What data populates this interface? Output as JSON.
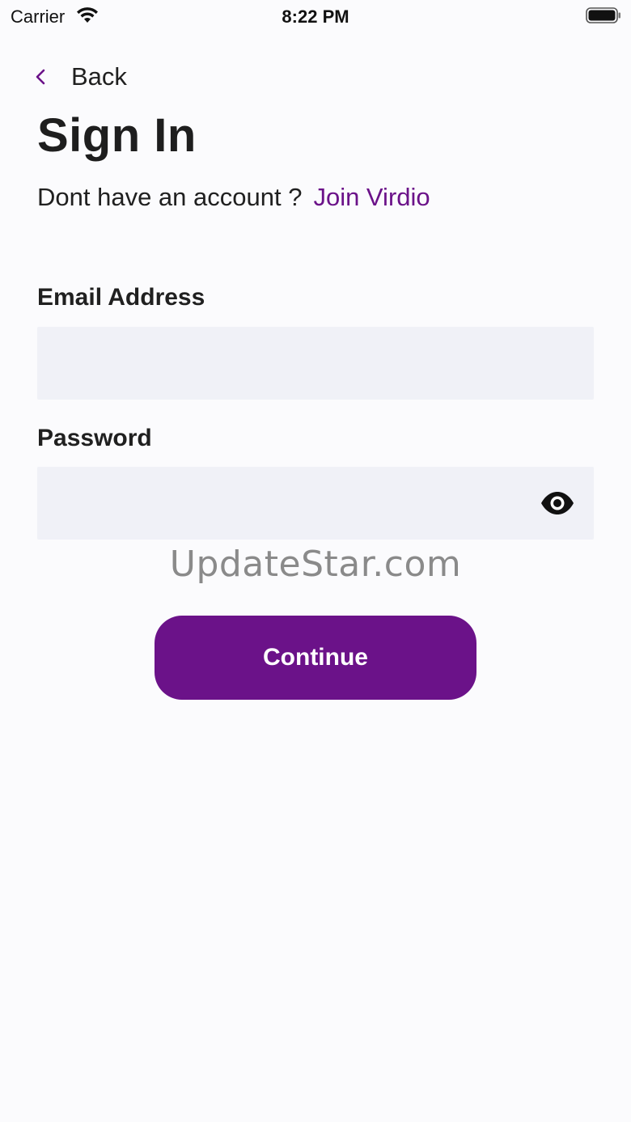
{
  "status_bar": {
    "carrier": "Carrier",
    "time": "8:22 PM"
  },
  "nav": {
    "back_label": "Back"
  },
  "header": {
    "title": "Sign In"
  },
  "signup_prompt": {
    "text": "Dont have an account ?",
    "link": "Join Virdio"
  },
  "form": {
    "email": {
      "label": "Email Address",
      "value": "",
      "placeholder": ""
    },
    "password": {
      "label": "Password",
      "value": "",
      "placeholder": ""
    },
    "submit_label": "Continue"
  },
  "watermark": "UpdateStar.com",
  "colors": {
    "accent": "#6b1289",
    "field_background": "#f0f1f7",
    "page_background": "#fbfbfd"
  },
  "icons": {
    "back": "chevron-left-icon",
    "password_toggle": "eye-icon",
    "wifi": "wifi-icon",
    "battery": "battery-icon"
  }
}
